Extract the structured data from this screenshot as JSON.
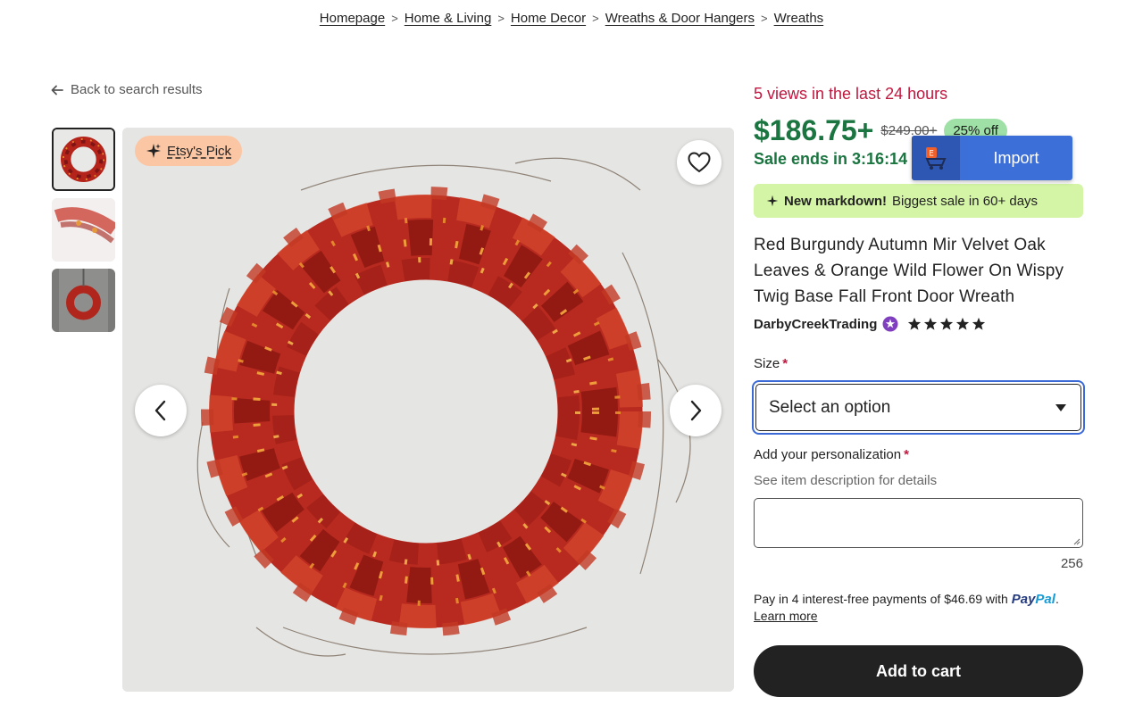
{
  "breadcrumb": [
    "Homepage",
    "Home & Living",
    "Home Decor",
    "Wreaths & Door Hangers",
    "Wreaths"
  ],
  "back_link": "Back to search results",
  "badge": {
    "label": "Etsy's Pick"
  },
  "product": {
    "views": "5 views in the last 24 hours",
    "price": "$186.75+",
    "old_price": "$249.00+",
    "discount": "25% off",
    "sale_ends": "Sale ends in 3:16:14",
    "markdown_bold": "New markdown!",
    "markdown_text": "Biggest sale in 60+ days",
    "title": "Red Burgundy Autumn Mir Velvet Oak Leaves & Orange Wild Flower On Wispy Twig Base Fall Front Door Wreath",
    "shop": "DarbyCreekTrading",
    "rating_stars": 5
  },
  "import": {
    "label": "Import"
  },
  "size": {
    "label": "Size",
    "placeholder": "Select an option"
  },
  "personalization": {
    "label": "Add your personalization",
    "hint": "See item description for details",
    "counter": "256"
  },
  "paypal": {
    "text": "Pay in 4 interest-free payments of $46.69 with",
    "brand_a": "Pay",
    "brand_b": "Pal",
    "suffix": ".",
    "learn_more": "Learn more"
  },
  "cart": {
    "label": "Add to cart"
  },
  "colors": {
    "accent_green": "#1b7540",
    "views_red": "#c0173f",
    "import_blue": "#3d6fd8",
    "markdown_bg": "#d4f5a5"
  }
}
